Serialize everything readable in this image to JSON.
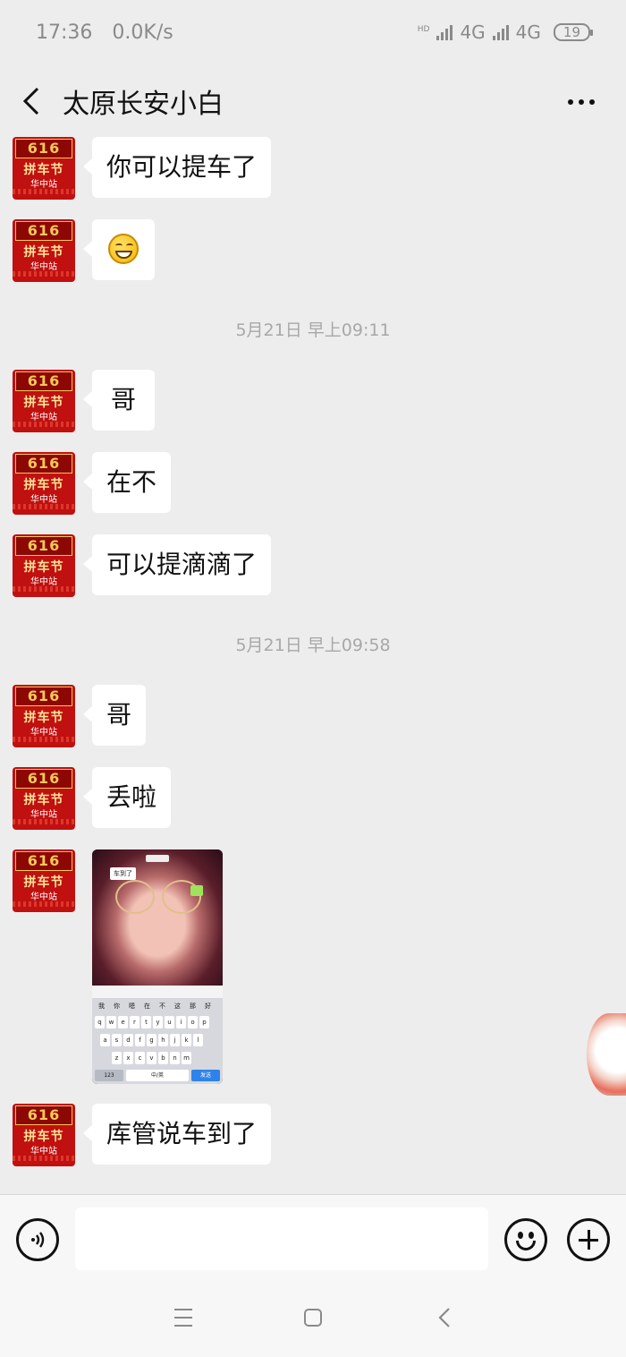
{
  "status_bar": {
    "time": "17:36",
    "net_speed": "0.0K/s",
    "signal1_label": "4G",
    "signal2_label": "4G",
    "hd_label": "HD",
    "battery": "19"
  },
  "header": {
    "title": "太原长安小白"
  },
  "avatar": {
    "top_text": "616",
    "mid_text": "拼车节",
    "sub_text": "华中站"
  },
  "messages": [
    {
      "type": "text",
      "text": "你可以提车了"
    },
    {
      "type": "emoji",
      "icon": "grinning-face-icon"
    },
    {
      "type": "timestamp",
      "text": "5月21日 早上09:11"
    },
    {
      "type": "text",
      "text": "哥"
    },
    {
      "type": "text",
      "text": "在不"
    },
    {
      "type": "text",
      "text": "可以提滴滴了"
    },
    {
      "type": "timestamp",
      "text": "5月21日 早上09:58"
    },
    {
      "type": "text",
      "text": "哥"
    },
    {
      "type": "text",
      "text": "丢啦"
    },
    {
      "type": "image",
      "description_text": "车到了"
    },
    {
      "type": "text",
      "text": "库管说车到了"
    }
  ],
  "image_message": {
    "chip_text": "车到了",
    "keyboard": {
      "row0": [
        "我",
        "你",
        "嗯",
        "在",
        "不",
        "这",
        "那",
        "好"
      ],
      "row1": [
        "q",
        "w",
        "e",
        "r",
        "t",
        "y",
        "u",
        "i",
        "o",
        "p"
      ],
      "row2": [
        "a",
        "s",
        "d",
        "f",
        "g",
        "h",
        "j",
        "k",
        "l"
      ],
      "row3": [
        "z",
        "x",
        "c",
        "v",
        "b",
        "n",
        "m"
      ],
      "num_label": "123",
      "space_label": "中/英",
      "send_label": "发送"
    }
  },
  "input_bar": {
    "placeholder": "",
    "voice_icon": "voice-icon",
    "emoji_icon": "smiley-icon",
    "plus_icon": "plus-icon"
  },
  "system_nav": {
    "icons": [
      "menu-icon",
      "home-icon",
      "back-icon"
    ]
  }
}
